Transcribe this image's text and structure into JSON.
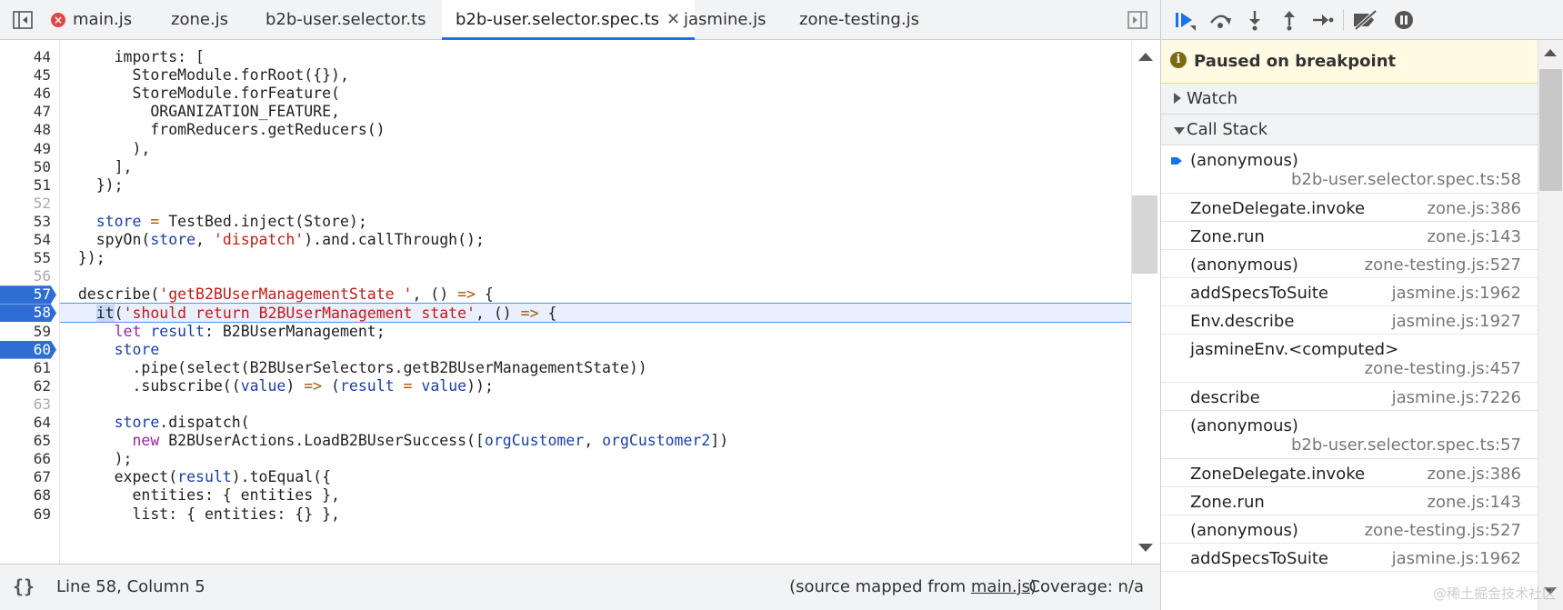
{
  "tabs": [
    {
      "label": "main.js",
      "error": true
    },
    {
      "label": "zone.js"
    },
    {
      "label": "b2b-user.selector.ts"
    },
    {
      "label": "b2b-user.selector.spec.ts",
      "active": true
    },
    {
      "label": "jasmine.js"
    },
    {
      "label": "zone-testing.js"
    }
  ],
  "editor": {
    "lines": [
      {
        "n": "44",
        "text": "    imports: ["
      },
      {
        "n": "45",
        "text": "      StoreModule.forRoot({}),"
      },
      {
        "n": "46",
        "text": "      StoreModule.forFeature("
      },
      {
        "n": "47",
        "text": "        ORGANIZATION_FEATURE,"
      },
      {
        "n": "48",
        "text": "        fromReducers.getReducers()"
      },
      {
        "n": "49",
        "text": "      ),"
      },
      {
        "n": "50",
        "text": "    ],"
      },
      {
        "n": "51",
        "text": "  });"
      },
      {
        "n": "52",
        "text": ""
      },
      {
        "n": "53",
        "text": "  store = TestBed.inject(Store);"
      },
      {
        "n": "54",
        "text": "  spyOn(store, 'dispatch').and.callThrough();"
      },
      {
        "n": "55",
        "text": "});"
      },
      {
        "n": "56",
        "text": ""
      },
      {
        "n": "57",
        "text": "describe('getB2BUserManagementState ', () => {"
      },
      {
        "n": "58",
        "text": "  it('should return B2BUserManagement state', () => {"
      },
      {
        "n": "59",
        "text": "    let result: B2BUserManagement;"
      },
      {
        "n": "60",
        "text": "    store"
      },
      {
        "n": "61",
        "text": "      .pipe(select(B2BUserSelectors.getB2BUserManagementState))"
      },
      {
        "n": "62",
        "text": "      .subscribe((value) => (result = value));"
      },
      {
        "n": "63",
        "text": ""
      },
      {
        "n": "64",
        "text": "    store.dispatch("
      },
      {
        "n": "65",
        "text": "      new B2BUserActions.LoadB2BUserSuccess([orgCustomer, orgCustomer2])"
      },
      {
        "n": "66",
        "text": "    );"
      },
      {
        "n": "67",
        "text": "    expect(result).toEqual({"
      },
      {
        "n": "68",
        "text": "      entities: { entities },"
      },
      {
        "n": "69",
        "text": "      list: { entities: {} },"
      }
    ],
    "breakpoints": [
      "57",
      "58",
      "60"
    ],
    "current_line": "58"
  },
  "status": {
    "braces": "{}",
    "position": "Line 58, Column 5",
    "source_mapped_prefix": "(source mapped from ",
    "source_mapped_file": "main.js",
    "source_mapped_suffix": ")",
    "coverage": "Coverage: n/a"
  },
  "debugger": {
    "paused_text": "Paused on breakpoint",
    "watch_label": "Watch",
    "callstack_label": "Call Stack",
    "frames": [
      {
        "fn": "(anonymous)",
        "loc": "b2b-user.selector.spec.ts:58",
        "current": true,
        "wrap": true
      },
      {
        "fn": "ZoneDelegate.invoke",
        "loc": "zone.js:386"
      },
      {
        "fn": "Zone.run",
        "loc": "zone.js:143"
      },
      {
        "fn": "(anonymous)",
        "loc": "zone-testing.js:527"
      },
      {
        "fn": "addSpecsToSuite",
        "loc": "jasmine.js:1962"
      },
      {
        "fn": "Env.describe",
        "loc": "jasmine.js:1927"
      },
      {
        "fn": "jasmineEnv.<computed>",
        "loc": "zone-testing.js:457",
        "wrap": true
      },
      {
        "fn": "describe",
        "loc": "jasmine.js:7226"
      },
      {
        "fn": "(anonymous)",
        "loc": "b2b-user.selector.spec.ts:57",
        "wrap": true
      },
      {
        "fn": "ZoneDelegate.invoke",
        "loc": "zone.js:386"
      },
      {
        "fn": "Zone.run",
        "loc": "zone.js:143"
      },
      {
        "fn": "(anonymous)",
        "loc": "zone-testing.js:527"
      },
      {
        "fn": "addSpecsToSuite",
        "loc": "jasmine.js:1962"
      }
    ]
  },
  "watermark": "@稀土掘金技术社区",
  "colors": {
    "accent": "#1a73e8",
    "breakpoint": "#2d6dd4",
    "paused_bg": "#fffbe3"
  }
}
